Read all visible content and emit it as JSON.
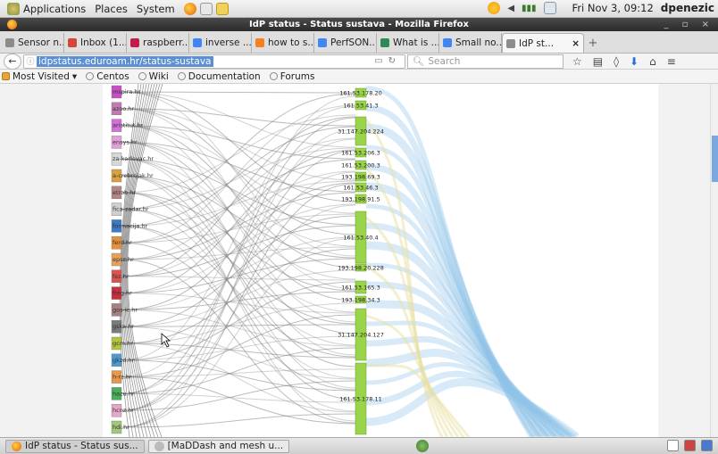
{
  "panel": {
    "menu_applications": "Applications",
    "menu_places": "Places",
    "menu_system": "System",
    "clock": "Fri Nov  3, 09:12",
    "user": "dpenezic"
  },
  "window": {
    "title": "IdP status - Status sustava - Mozilla Firefox"
  },
  "tabs": [
    {
      "label": "Sensor n...",
      "icon_color": "#8c8c8c"
    },
    {
      "label": "Inbox (1...",
      "icon_color": "#d44638"
    },
    {
      "label": "raspberr...",
      "icon_color": "#c51a4a"
    },
    {
      "label": "inverse ...",
      "icon_color": "#4285f4"
    },
    {
      "label": "how to s...",
      "icon_color": "#f48024"
    },
    {
      "label": "PerfSON...",
      "icon_color": "#4285f4"
    },
    {
      "label": "What is ...",
      "icon_color": "#2e8b57"
    },
    {
      "label": "Small no...",
      "icon_color": "#4285f4"
    },
    {
      "label": "IdP st...",
      "icon_color": "#8c8c8c"
    }
  ],
  "nav": {
    "url": "idpstatus.eduroam.hr/status-sustava",
    "search_placeholder": "Search"
  },
  "bookmarks": [
    {
      "label": "Most Visited"
    },
    {
      "label": "Centos"
    },
    {
      "label": "Wiki"
    },
    {
      "label": "Documentation"
    },
    {
      "label": "Forums"
    }
  ],
  "left_nodes": [
    {
      "label": "mspira.hr",
      "color": "#c64ec6"
    },
    {
      "label": "azoo.hr",
      "color": "#c07bb4"
    },
    {
      "label": "aristitut.hr",
      "color": "#d36fd6"
    },
    {
      "label": "ensys.hr",
      "color": "#e2a0d7"
    },
    {
      "label": "za-karlovac.hr",
      "color": "#d8d8d8"
    },
    {
      "label": "a-crebrnjak.hr",
      "color": "#d9a13e"
    },
    {
      "label": "etrob.hr",
      "color": "#b38686"
    },
    {
      "label": "fica-zadar.hr",
      "color": "#cfcfcf"
    },
    {
      "label": "formacija.hr",
      "color": "#3b7ac4"
    },
    {
      "label": "ferd.hr",
      "color": "#e69138"
    },
    {
      "label": "epsz.hr",
      "color": "#e8a15d"
    },
    {
      "label": "fez.hr",
      "color": "#e05050"
    },
    {
      "label": "freg.hr",
      "color": "#c83040"
    },
    {
      "label": "gos-ic.hr",
      "color": "#a88080"
    },
    {
      "label": "gska.hr",
      "color": "#7a7a7a"
    },
    {
      "label": "gcm.hr",
      "color": "#b5c43c"
    },
    {
      "label": "gkzd.hr",
      "color": "#4a9bd4"
    },
    {
      "label": "h-rz.hr",
      "color": "#e8974a"
    },
    {
      "label": "hazu.hr",
      "color": "#4aae5a"
    },
    {
      "label": "hcnz.hr",
      "color": "#e6a6c8"
    },
    {
      "label": "hdi.hr",
      "color": "#a0c878"
    }
  ],
  "ip_nodes": [
    {
      "label": "161.53.178.20"
    },
    {
      "label": "161.53.41.3"
    },
    {
      "label": "31.147.204.224"
    },
    {
      "label": "161.53.206.3"
    },
    {
      "label": "161.53.200.3"
    },
    {
      "label": "193.198.69.3"
    },
    {
      "label": "161.53.46.3"
    },
    {
      "label": "193.198.91.5"
    },
    {
      "label": "161.53.40.4"
    },
    {
      "label": "193.198.20.228"
    },
    {
      "label": "161.53.165.3"
    },
    {
      "label": "193.198.34.3"
    },
    {
      "label": "31.147.204.127"
    },
    {
      "label": "161.53.178.11"
    }
  ],
  "taskbar": [
    {
      "label": "IdP status - Status sus...",
      "active": true
    },
    {
      "label": "[MaDDash and mesh u...",
      "active": false
    }
  ]
}
